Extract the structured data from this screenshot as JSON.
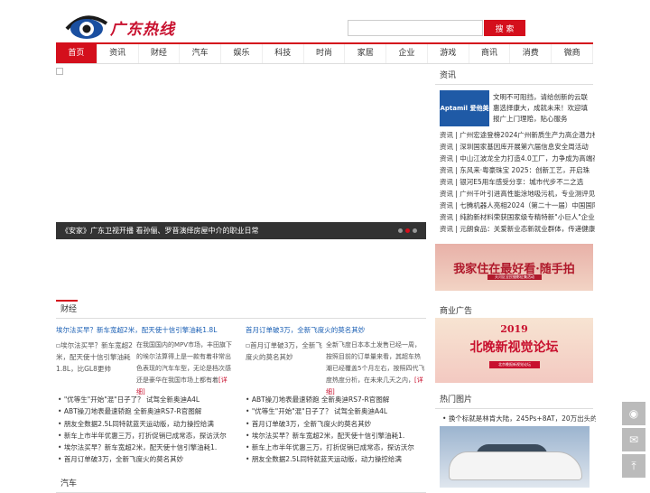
{
  "header": {
    "logo_text": "广东热线",
    "search_placeholder": "",
    "search_button": "搜 索"
  },
  "nav": [
    {
      "label": "首页",
      "active": true
    },
    {
      "label": "资讯"
    },
    {
      "label": "财经"
    },
    {
      "label": "汽车"
    },
    {
      "label": "娱乐"
    },
    {
      "label": "科技"
    },
    {
      "label": "时尚"
    },
    {
      "label": "家居"
    },
    {
      "label": "企业"
    },
    {
      "label": "游戏"
    },
    {
      "label": "商讯"
    },
    {
      "label": "消费"
    },
    {
      "label": "微商"
    }
  ],
  "slider": {
    "caption": "《安家》广东卫视开播 看孙俪、罗晋演绎房屋中介的职业日常"
  },
  "sidebar": {
    "news_title": "资讯",
    "promo_logo": "Aptamil 爱他美",
    "promo_text": "文明不可阻挡，请给创新的云联惠选择康大，成就未来！欢迎填报广上门理赔，贴心服务",
    "news": [
      "资讯 | 广州宏途登榜2024广州新质生产力高企潜力榜",
      "资讯 | 深圳国家基因库开展第六届信息安全周活动",
      "资讯 | 中山江波龙全力打造4.0工厂，力争成为高端存",
      "资讯 | 东风来·粤豪珠宝 2025：创新工艺，开启珠",
      "资讯 | 银河E5用车感受分享：城市代步不二之选",
      "资讯 | 广州千叶引进高性能涂地吸污机，专业测评见",
      "资讯 | 七腾机器人亮相2024（第二十一届）中国国际",
      "资讯 | 纯韵新材料荣获国家级专精特新\"小巨人\"企业荣",
      "资讯 | 元朗食品：关爱新业态新就业群体，传递健康"
    ],
    "banner1_title": "我家住在最好看·随手拍",
    "banner1_sub": "天河区全民摄影征集活动",
    "ad_title": "商业广告",
    "banner2_year": "2019",
    "banner2_title": "北晚新视觉论坛",
    "banner2_sub": "北京晚报新视觉论坛",
    "hot_title": "热门图片",
    "hot_item": "换个标就是林肯大陆，245Ps+8AT，20万出头的福"
  },
  "main": {
    "section_title": "财经",
    "col_a": {
      "title": "埃尔法买早？新车宽超2米，配天使十信引擎油耗1.8L",
      "img_alt": "埃尔法买早？新车宽超2米，配天使十信引擎油耗1.8L，比GL8更帅",
      "text": "在我国国内的MPV市场，丰田旗下的埃尔法算得上是一款有着非常出色表现的汽车车型，无论是档次感还是豪华在我国市场上都有着",
      "more": "[详细]"
    },
    "col_b": {
      "title": "首月订单破3万，全新飞度火的莫名其妙",
      "img_alt": "首月订单破3万，全新飞度火的莫名其妙",
      "text": "全新飞度日本本土发售已经一周，按照目前的订单量来看，其超车热潮已经覆盖5个月左右，按照四代飞度热度分析，在未来几天之内，",
      "more": "[详细]"
    },
    "list_a": [
      "\"优等生\"开始\"混\"日子了？ 试驾全新奥迪A4L",
      "ABT操刀地表最速轿跑 全新奥迪RS7-R官图解",
      "朋友全数据2.5L同特就蓝天运动版，动力操控给满",
      "新车上市半年优惠三万，打折促销已成常态，探访沃尔",
      "埃尔法买早？新车宽超2米，配天使十信引擎油耗1.",
      "首月订单破3万，全新飞度火的莫名其妙"
    ],
    "list_b": [
      "ABT操刀地表最速轿跑 全新奥迪RS7-R官图解",
      "\"优等生\"开始\"混\"日子了？ 试驾全新奥迪A4L",
      "首月订单破3万，全新飞度火的莫名其妙",
      "埃尔法买早？新车宽超2米，配天使十信引擎油耗1.",
      "新车上市半年优惠三万，打折促销已成常态，探访沃尔",
      "朋友全数据2.5L同特就蓝天运动版，动力操控给满"
    ],
    "section2_title": "汽车"
  },
  "float": {
    "weibo_icon": "weibo-icon",
    "mail_icon": "mail-icon",
    "top_icon": "back-to-top-icon"
  }
}
